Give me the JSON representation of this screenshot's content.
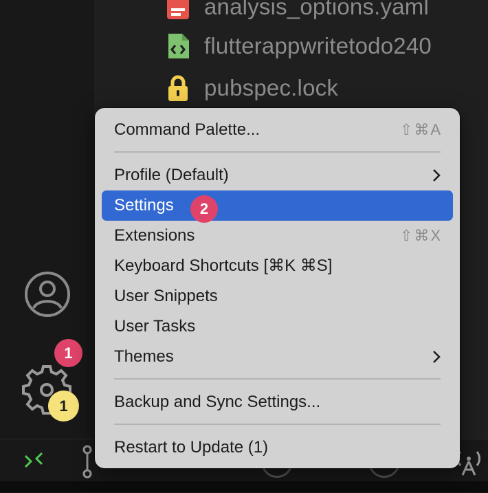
{
  "explorer": {
    "files": [
      {
        "name": "analysis_options.yaml",
        "icon": "yaml-file-icon",
        "color": "#e5534b"
      },
      {
        "name": "flutterappwritetodo240",
        "icon": "code-file-icon",
        "color": "#7ec16e"
      },
      {
        "name": "pubspec.lock",
        "icon": "lock-file-icon",
        "color": "#f3cf4f"
      }
    ]
  },
  "activity_bar": {
    "account_icon": "account-icon",
    "manage_icon": "gear-icon"
  },
  "badges": {
    "manage_step": "1",
    "manage_count": "1",
    "settings_step": "2"
  },
  "menu": {
    "items": [
      {
        "label": "Command Palette...",
        "shortcut": "⇧⌘A"
      },
      {
        "label": "Profile (Default)",
        "submenu": true
      },
      {
        "label": "Settings",
        "highlighted": true
      },
      {
        "label": "Extensions",
        "shortcut": "⇧⌘X"
      },
      {
        "label": "Keyboard Shortcuts [⌘K ⌘S]"
      },
      {
        "label": "User Snippets"
      },
      {
        "label": "User Tasks"
      },
      {
        "label": "Themes",
        "submenu": true
      },
      {
        "label": "Backup and Sync Settings..."
      },
      {
        "label": "Restart to Update (1)"
      }
    ]
  },
  "colors": {
    "accent": "#3268d1",
    "badge_red": "#e0436a",
    "badge_yellow": "#f6e27a",
    "remote_green": "#4ec94e"
  }
}
